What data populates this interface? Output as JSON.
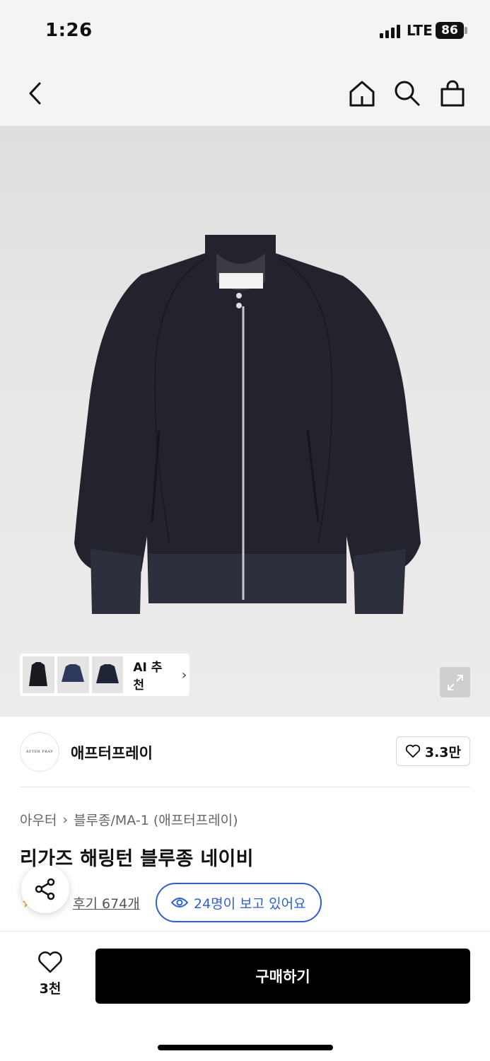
{
  "status_bar": {
    "time": "1:26",
    "network": "LTE",
    "battery": "86"
  },
  "nav": {
    "back_icon": "chevron-left-icon",
    "home_icon": "home-icon",
    "search_icon": "search-icon",
    "cart_icon": "shopping-bag-icon"
  },
  "hero": {
    "ai_recommend_label": "AI 추천",
    "thumbnails": [
      "black-jacket",
      "navy-bomber",
      "navy-jacket"
    ]
  },
  "brand": {
    "logo_text": "AFTER PRAY",
    "name": "애프터프레이",
    "likes": "3.3만"
  },
  "product": {
    "breadcrumb": [
      "아우터",
      "블루종/MA-1 (애프터프레이)"
    ],
    "title": "리가즈 해링턴 블루종 네이비",
    "reviews": "후기 674개",
    "viewers": "24명이 보고 있어요"
  },
  "bottom": {
    "wish_count": "3천",
    "buy_label": "구매하기"
  },
  "colors": {
    "accent_blue": "#2f5fd0",
    "star": "#f5a623",
    "jacket_navy": "#23232d"
  }
}
